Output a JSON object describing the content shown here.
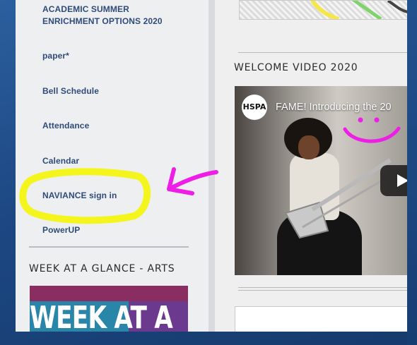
{
  "sidebar": {
    "links": [
      {
        "label": "ACADEMIC SUMMER"
      },
      {
        "label": "ENRICHMENT OPTIONS 2020"
      },
      {
        "label": "paper*"
      },
      {
        "label": "Bell Schedule"
      },
      {
        "label": "Attendance"
      },
      {
        "label": "Calendar"
      },
      {
        "label": "NAVIANCE sign in"
      },
      {
        "label": "PowerUP"
      }
    ],
    "week_heading": "WEEK AT A GLANCE - ARTS",
    "week_logo_text": "WEEK AT A"
  },
  "main": {
    "video_heading": "WELCOME VIDEO 2020",
    "video": {
      "channel_logo": "HSPA",
      "title": "FAME! Introducing the 20"
    }
  },
  "colors": {
    "link": "#2f4b7a",
    "highlight_yellow": "#f5f51e",
    "annotation_magenta": "#ee1ee6",
    "background_blue": "#1c4782"
  }
}
